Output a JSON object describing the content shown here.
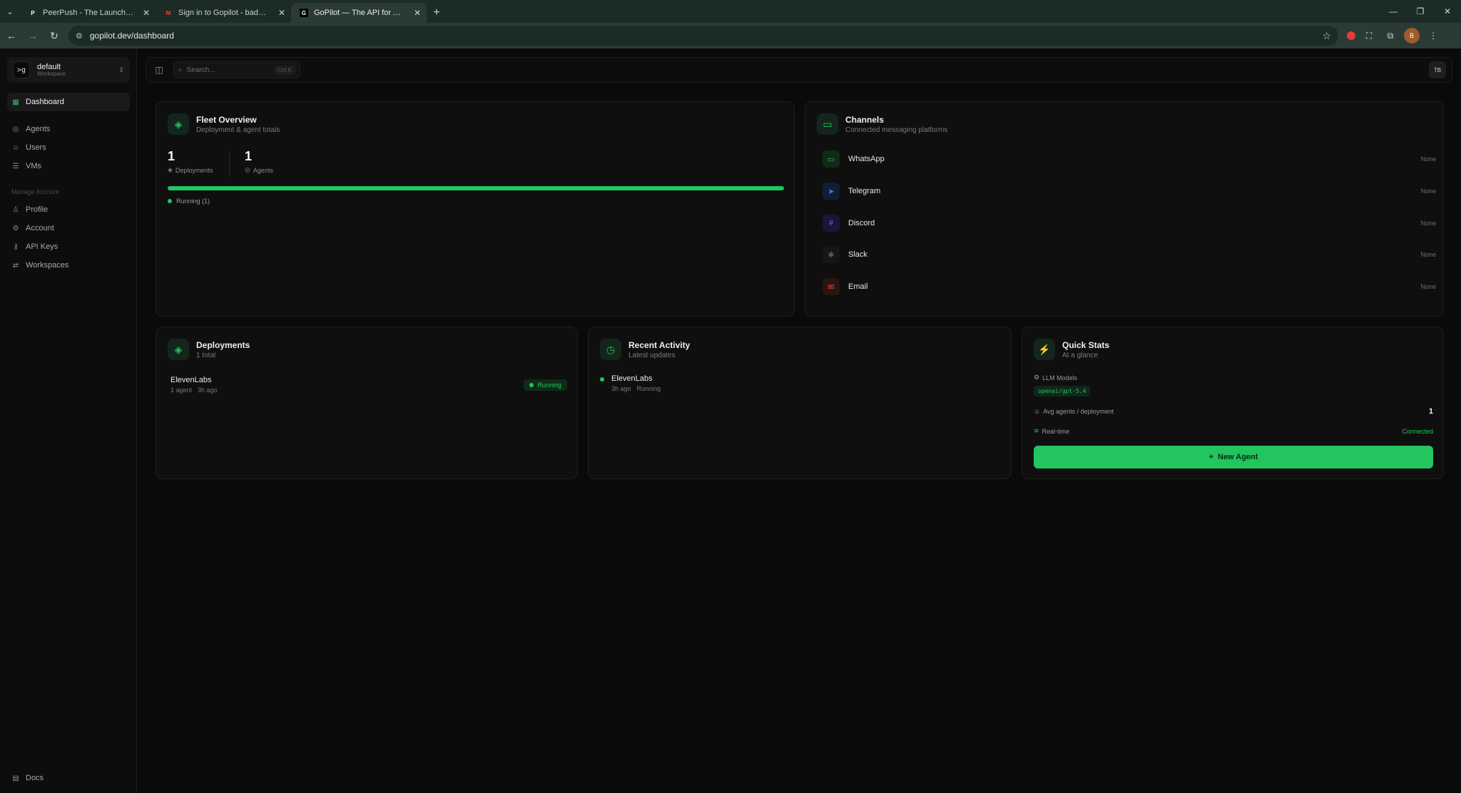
{
  "browser": {
    "tabs": [
      {
        "title": "PeerPush - The Launch and Dis",
        "favicon": "P",
        "active": false
      },
      {
        "title": "Sign in to Gopilot - badelitatib",
        "favicon": "M",
        "active": false
      },
      {
        "title": "GoPilot — The API for AI Agen",
        "favicon": "G",
        "active": true
      }
    ],
    "url": "gopilot.dev/dashboard",
    "ext_avatar": "B"
  },
  "sidebar": {
    "workspace_name": "default",
    "workspace_sub": "Workspace",
    "logo_text": ">g",
    "items": [
      {
        "label": "Dashboard",
        "icon": "grid-icon",
        "active": true
      },
      {
        "label": "Agents",
        "icon": "bot-icon"
      },
      {
        "label": "Users",
        "icon": "users-icon"
      },
      {
        "label": "VMs",
        "icon": "server-icon"
      }
    ],
    "section_label": "Manage Account",
    "account_items": [
      {
        "label": "Profile",
        "icon": "user-icon"
      },
      {
        "label": "Account",
        "icon": "gear-icon"
      },
      {
        "label": "API Keys",
        "icon": "key-icon"
      },
      {
        "label": "Workspaces",
        "icon": "swap-icon"
      }
    ],
    "docs_label": "Docs"
  },
  "topbar": {
    "search_placeholder": "Search...",
    "search_shortcut": "Ctrl K",
    "avatar_initials": "TB"
  },
  "fleet": {
    "title": "Fleet Overview",
    "subtitle": "Deployment & agent totals",
    "deployments_count": "1",
    "deployments_label": "Deployments",
    "agents_count": "1",
    "agents_label": "Agents",
    "running_fraction": 1.0,
    "legend": "Running (1)"
  },
  "channels": {
    "title": "Channels",
    "subtitle": "Connected messaging platforms",
    "items": [
      {
        "name": "WhatsApp",
        "status": "None",
        "icon": "chat-icon",
        "color": "#22c55e"
      },
      {
        "name": "Telegram",
        "status": "None",
        "icon": "send-icon",
        "color": "#3b82f6"
      },
      {
        "name": "Discord",
        "status": "None",
        "icon": "hash-icon",
        "color": "#6366f1"
      },
      {
        "name": "Slack",
        "status": "None",
        "icon": "slack-icon",
        "color": "#6b6b6b"
      },
      {
        "name": "Email",
        "status": "None",
        "icon": "mail-icon",
        "color": "#ef4444"
      }
    ]
  },
  "deployments": {
    "title": "Deployments",
    "subtitle": "1 total",
    "items": [
      {
        "name": "ElevenLabs",
        "agents": "1 agent",
        "time": "3h ago",
        "status": "Running"
      }
    ]
  },
  "activity": {
    "title": "Recent Activity",
    "subtitle": "Latest updates",
    "items": [
      {
        "name": "ElevenLabs",
        "time": "3h ago",
        "status": "Running"
      }
    ]
  },
  "quick_stats": {
    "title": "Quick Stats",
    "subtitle": "At a glance",
    "llm_label": "LLM Models",
    "llm_model": "openai/gpt-5.4",
    "avg_label": "Avg agents / deployment",
    "avg_value": "1",
    "realtime_label": "Real-time",
    "realtime_status": "Connected",
    "new_agent_label": "New Agent"
  },
  "colors": {
    "accent": "#22c55e",
    "background": "#0a0a0a",
    "card": "#0f0f0f"
  }
}
